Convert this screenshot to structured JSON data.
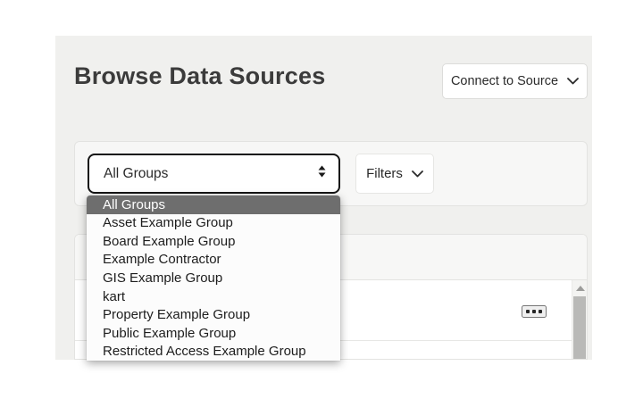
{
  "page": {
    "title": "Browse Data Sources"
  },
  "toolbar": {
    "connect_button_label": "Connect to Source"
  },
  "filter_bar": {
    "group_select_value": "All Groups",
    "filters_button_label": "Filters"
  },
  "group_dropdown": {
    "selected_option": "All Groups",
    "selected_index": 0,
    "options": [
      "All Groups",
      "Asset Example Group",
      "Board Example Group",
      "Example Contractor",
      "GIS Example Group",
      "kart",
      "Property Example Group",
      "Public Example Group",
      "Restricted Access Example Group"
    ]
  },
  "results_panel": {
    "row_action_icon": "ellipsis-icon",
    "scrollbar_up_icon": "triangle-up-icon"
  },
  "icons": {
    "connect_button": "chevron-down-icon",
    "filters_button": "chevron-down-icon",
    "group_select": "up-down-stepper-icon"
  },
  "colors": {
    "page_bg": "#ffffff",
    "card_bg": "#f0f0ee",
    "panel_bg": "#f7f7f6",
    "panel_border": "#e3e3e1",
    "select_focus_border": "#141414",
    "dropdown_bg": "#fcfcfc",
    "dropdown_highlight_bg": "#6e6e6e",
    "dropdown_highlight_text": "#ffffff",
    "title_text": "#3b3b3b",
    "scrollbar_thumb": "#b9b9b7"
  }
}
